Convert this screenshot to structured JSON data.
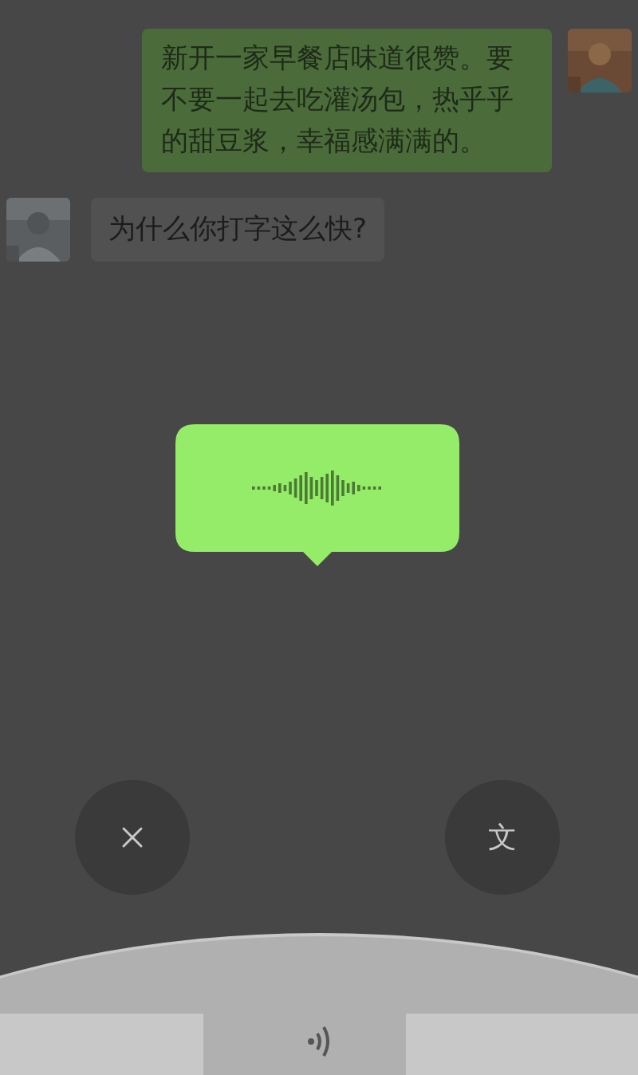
{
  "messages": [
    {
      "kind": "sent",
      "text": "新开一家早餐店味道很赞。要不要一起去吃灌汤包，热乎乎的甜豆浆，幸福感满满的。"
    },
    {
      "kind": "received",
      "text": "为什么你打字这么快?"
    }
  ],
  "voice_overlay": {
    "cancel_button": {
      "kind": "cancel"
    },
    "convert_button": {
      "label": "文"
    }
  }
}
